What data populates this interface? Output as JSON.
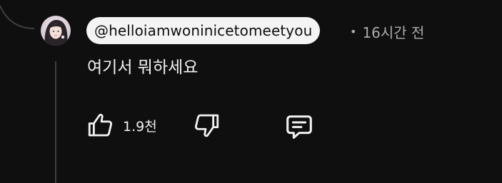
{
  "comment": {
    "author": "@helloiamwoninicetomeetyou",
    "separator": "•",
    "timestamp": "16시간 전",
    "text": "여기서 뭐하세요"
  },
  "actions": {
    "like_count": "1.9천"
  },
  "icons": {
    "like": "thumbs-up-icon",
    "dislike": "thumbs-down-icon",
    "reply": "comment-icon"
  },
  "colors": {
    "background": "#0f0f0f",
    "author_chip": "#f4f4f4",
    "text": "#f1f1f1",
    "meta_text": "#aaaaaa",
    "thread_line": "#3f3f3f"
  }
}
